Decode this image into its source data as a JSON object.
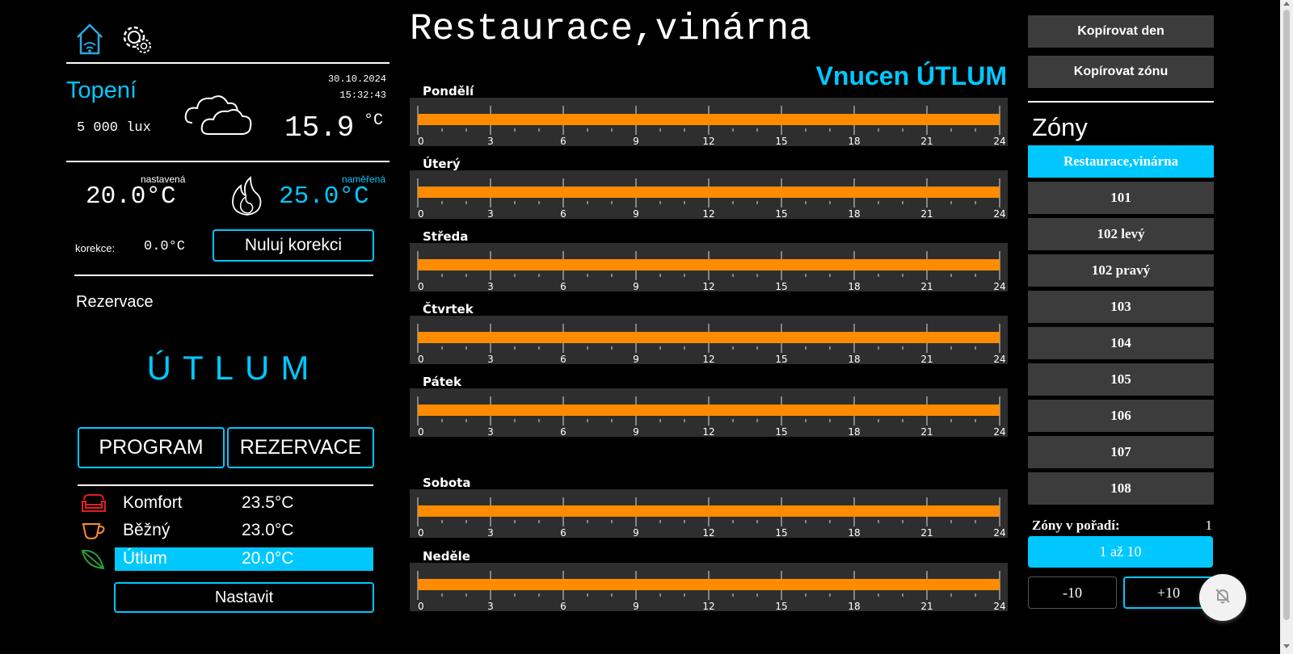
{
  "header": {
    "title": "Restaurace,vinárna",
    "forced_mode": "Vnucen ÚTLUM"
  },
  "status": {
    "section": "Topení",
    "date": "30.10.2024",
    "time": "15:32:43",
    "lux": "5 000 lux",
    "outside_temp": "15.9",
    "outside_unit": "°C",
    "set_label": "nastavená",
    "set_value": "20.0°C",
    "measured_label": "naměřená",
    "measured_value": "25.0°C",
    "correction_label": "korekce:",
    "correction_value": "0.0°C",
    "reset_correction_button": "Nuluj korekci",
    "reservation_label": "Rezervace",
    "current_mode": "ÚTLUM",
    "program_button": "PROGRAM",
    "reservation_button": "REZERVACE"
  },
  "modes": [
    {
      "name": "Komfort",
      "value": "23.5°C",
      "icon": "sofa-icon",
      "active": false
    },
    {
      "name": "Běžný",
      "value": "23.0°C",
      "icon": "cup-icon",
      "active": false
    },
    {
      "name": "Útlum",
      "value": "20.0°C",
      "icon": "leaf-icon",
      "active": true
    }
  ],
  "set_button": "Nastavit",
  "schedule": {
    "ticks": [
      "0",
      "3",
      "6",
      "9",
      "12",
      "15",
      "18",
      "21",
      "24"
    ],
    "bar_color": "#ff8c00",
    "days": [
      {
        "name": "Pondělí",
        "level": "full"
      },
      {
        "name": "Úterý",
        "level": "full"
      },
      {
        "name": "Středa",
        "level": "full"
      },
      {
        "name": "Čtvrtek",
        "level": "full"
      },
      {
        "name": "Pátek",
        "level": "full"
      },
      {
        "name": "Sobota",
        "level": "full"
      },
      {
        "name": "Neděle",
        "level": "full"
      }
    ]
  },
  "sidebar": {
    "copy_day": "Kopírovat den",
    "copy_zone": "Kopírovat zónu",
    "zones_title": "Zóny",
    "zones": [
      "Restaurace,vinárna",
      "101",
      "102 levý",
      "102 pravý",
      "103",
      "104",
      "105",
      "106",
      "107",
      "108"
    ],
    "active_zone": 0,
    "order_label": "Zóny v pořadí:",
    "order_value": "1",
    "range_button": "1 až 10",
    "prev_button": "-10",
    "next_button": "+10"
  },
  "colors": {
    "accent": "#00c8ff",
    "bar": "#ff8c00",
    "panel": "#2e2e2e",
    "button": "#3c3c3c"
  }
}
